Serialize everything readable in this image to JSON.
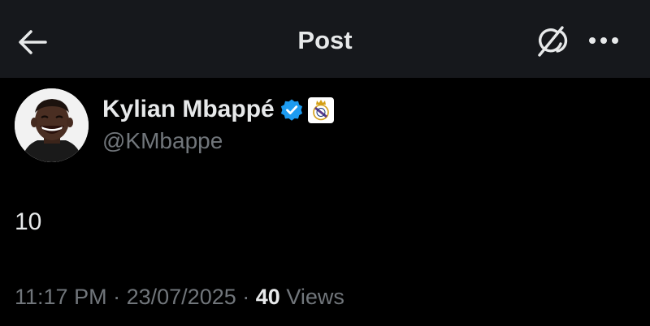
{
  "header": {
    "title": "Post",
    "back_icon": "arrow-left-icon",
    "grok_icon": "grok-icon",
    "more_icon": "more-horizontal-icon"
  },
  "author": {
    "name": "Kylian Mbappé",
    "handle": "@KMbappe",
    "verified": true,
    "verified_color": "#1d9bf0",
    "affiliate_badge": "real-madrid-crest-icon"
  },
  "post": {
    "text": "10",
    "time": "11:17 PM",
    "separator": "·",
    "date": "23/07/2025",
    "views_count": "40",
    "views_label": "Views"
  },
  "colors": {
    "background": "#000000",
    "header_background": "#16181c",
    "primary_text": "#e7e9ea",
    "secondary_text": "#71767b",
    "accent": "#1d9bf0"
  }
}
